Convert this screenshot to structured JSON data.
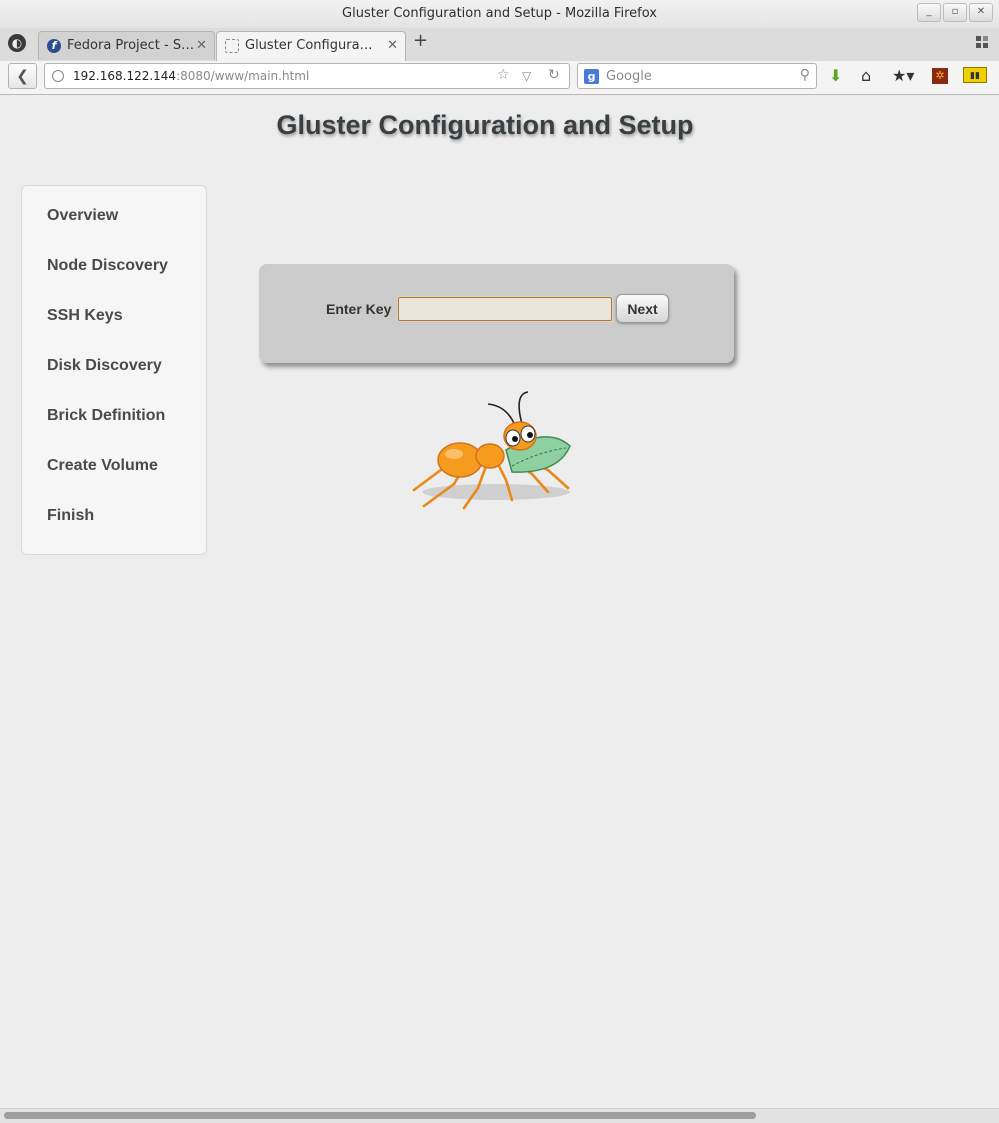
{
  "window": {
    "title": "Gluster Configuration and Setup - Mozilla Firefox",
    "controls": [
      "_",
      "▫",
      "✕"
    ]
  },
  "tabs": [
    {
      "label": "Fedora Project - St…",
      "active": false,
      "icon": "fedora-icon"
    },
    {
      "label": "Gluster Configuratio…",
      "active": true,
      "icon": "blank-page-icon"
    }
  ],
  "navbar": {
    "url_host": "192.168.122.144",
    "url_rest": ":8080/www/main.html",
    "search_placeholder": "Google",
    "search_engine_icon": "g-icon"
  },
  "page": {
    "title": "Gluster Configuration and Setup",
    "sidebar": {
      "items": [
        {
          "label": "Overview"
        },
        {
          "label": "Node Discovery"
        },
        {
          "label": "SSH Keys"
        },
        {
          "label": "Disk Discovery"
        },
        {
          "label": "Brick Definition"
        },
        {
          "label": "Create Volume"
        },
        {
          "label": "Finish"
        }
      ]
    },
    "form": {
      "key_label": "Enter Key",
      "key_value": "",
      "next_label": "Next"
    }
  },
  "colors": {
    "page_bg": "#ededed",
    "panel_bg": "#cbcbcb",
    "title_text": "#3a3f42",
    "ant_body": "#f59b1e"
  }
}
